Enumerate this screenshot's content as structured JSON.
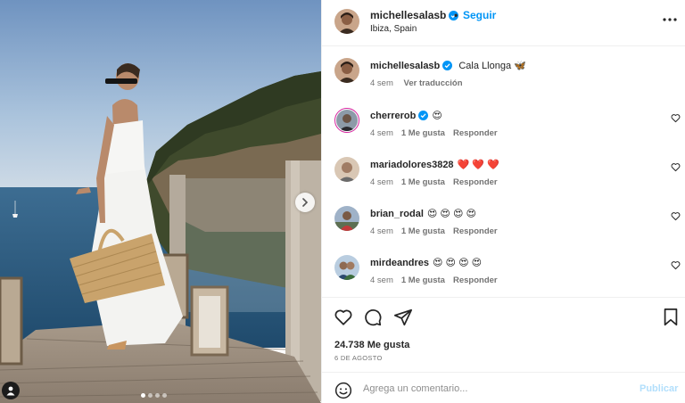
{
  "post": {
    "author": "michellesalasb",
    "follow_label": "Seguir",
    "separator": "•",
    "location": "Ibiza, Spain"
  },
  "caption": {
    "user": "michellesalasb",
    "text": "Cala Llonga 🦋",
    "age": "4 sem",
    "translate_label": "Ver traducción"
  },
  "comments": [
    {
      "user": "cherrerob",
      "text": "😍",
      "age": "4 sem",
      "likes": "1 Me gusta",
      "reply": "Responder"
    },
    {
      "user": "mariadolores3828",
      "text": "❤️ ❤️ ❤️",
      "age": "4 sem",
      "likes": "1 Me gusta",
      "reply": "Responder"
    },
    {
      "user": "brian_rodal",
      "text": "😍 😍 😍 😍",
      "age": "4 sem",
      "likes": "1 Me gusta",
      "reply": "Responder"
    },
    {
      "user": "mirdeandres",
      "text": "😍 😍 😍 😍",
      "age": "4 sem",
      "likes": "1 Me gusta",
      "reply": "Responder"
    }
  ],
  "stats": {
    "likes": "24.738 Me gusta",
    "date": "6 DE AGOSTO"
  },
  "composer": {
    "placeholder": "Agrega un comentario...",
    "post_label": "Publicar"
  },
  "icons": {
    "verified": "verified-badge-icon",
    "more": "more-options-icon",
    "like": "heart-icon",
    "comment": "comment-icon",
    "share": "send-icon",
    "save": "bookmark-icon",
    "emoji": "emoji-icon",
    "next": "chevron-right-icon",
    "tags": "user-tag-icon"
  },
  "colors": {
    "link_blue": "#0095f6",
    "verified_blue": "#0095f6",
    "muted": "#737373",
    "post_disabled": "#b2dffc"
  },
  "carousel": {
    "slides": 4,
    "active": 1
  }
}
